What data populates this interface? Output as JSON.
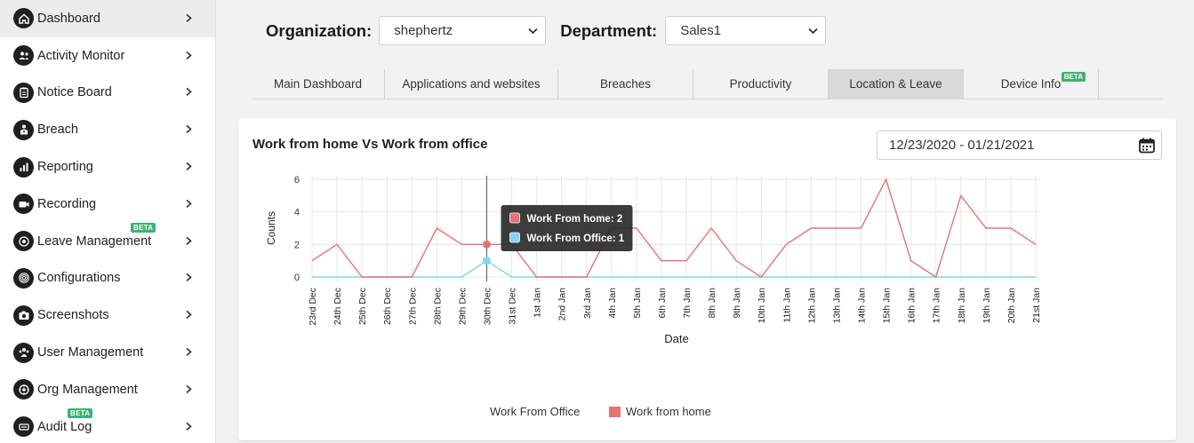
{
  "sidebar": {
    "items": [
      {
        "label": "Dashboard",
        "icon": "home-icon",
        "active": true
      },
      {
        "label": "Activity Monitor",
        "icon": "users-icon"
      },
      {
        "label": "Notice Board",
        "icon": "clipboard-icon"
      },
      {
        "label": "Breach",
        "icon": "person-alert-icon"
      },
      {
        "label": "Reporting",
        "icon": "bar-chart-icon"
      },
      {
        "label": "Recording",
        "icon": "video-camera-icon"
      },
      {
        "label": "Leave Management",
        "icon": "target-icon",
        "badge": "BETA"
      },
      {
        "label": "Configurations",
        "icon": "fingerprint-icon"
      },
      {
        "label": "Screenshots",
        "icon": "camera-icon"
      },
      {
        "label": "User Management",
        "icon": "user-group-icon"
      },
      {
        "label": "Org Management",
        "icon": "org-icon"
      },
      {
        "label": "Audit Log",
        "icon": "log-icon",
        "badge": "BETA"
      }
    ]
  },
  "filters": {
    "organization_label": "Organization:",
    "organization_value": "shephertz",
    "department_label": "Department:",
    "department_value": "Sales1"
  },
  "tabs": [
    {
      "label": "Main Dashboard"
    },
    {
      "label": "Applications and websites"
    },
    {
      "label": "Breaches"
    },
    {
      "label": "Productivity"
    },
    {
      "label": "Location & Leave",
      "active": true
    },
    {
      "label": "Device Info",
      "badge": "BETA"
    }
  ],
  "card": {
    "title": "Work from home Vs Work from office",
    "date_range": "12/23/2020 - 01/21/2021"
  },
  "colors": {
    "home": "#e57373",
    "office": "#81d4fa",
    "accent_badge": "#3cb371"
  },
  "chart_data": {
    "type": "line",
    "xlabel": "Date",
    "ylabel": "Counts",
    "ylim": [
      0,
      6
    ],
    "yticks": [
      0,
      2,
      4,
      6
    ],
    "categories": [
      "23rd Dec",
      "24th Dec",
      "25th Dec",
      "26th Dec",
      "27th Dec",
      "28th Dec",
      "29th Dec",
      "30th Dec",
      "31st Dec",
      "1st Jan",
      "2nd Jan",
      "3rd Jan",
      "4th Jan",
      "5th Jan",
      "6th Jan",
      "7th Jan",
      "8th Jan",
      "9th Jan",
      "10th Jan",
      "11th Jan",
      "12th Jan",
      "13th Jan",
      "14th Jan",
      "15th Jan",
      "16th Jan",
      "17th Jan",
      "18th Jan",
      "19th Jan",
      "20th Jan",
      "21st Jan"
    ],
    "series": [
      {
        "name": "Work from home",
        "color": "#e57373",
        "values": [
          1,
          2,
          0,
          0,
          0,
          3,
          2,
          2,
          2,
          0,
          0,
          0,
          3,
          3,
          1,
          1,
          3,
          1,
          0,
          2,
          3,
          3,
          3,
          6,
          1,
          0,
          5,
          3,
          3,
          2
        ]
      },
      {
        "name": "Work From Office",
        "color": "#81d4fa",
        "values": [
          0,
          0,
          0,
          0,
          0,
          0,
          0,
          1,
          0,
          0,
          0,
          0,
          0,
          0,
          0,
          0,
          0,
          0,
          0,
          0,
          0,
          0,
          0,
          0,
          0,
          0,
          0,
          0,
          0,
          0
        ]
      }
    ],
    "legend": [
      {
        "label": "Work From Office"
      },
      {
        "label": "Work from home"
      }
    ],
    "legend_position": "bottom",
    "grid": true,
    "tooltip": {
      "category_index": 7,
      "lines": [
        "Work From home: 2",
        "Work From Office: 1"
      ]
    }
  }
}
